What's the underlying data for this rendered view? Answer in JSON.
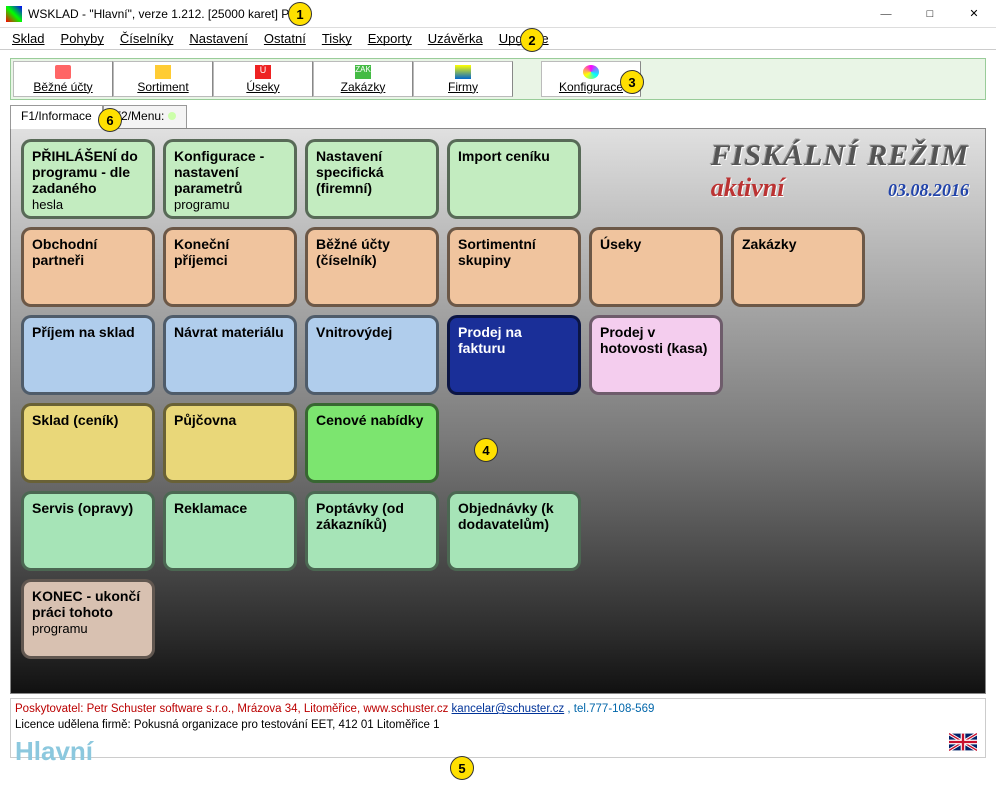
{
  "window": {
    "title": "WSKLAD - \"Hlavní\", verze 1.212. [25000 karet] PC2:"
  },
  "menu": {
    "items": [
      "Sklad",
      "Pohyby",
      "Číselníky",
      "Nastavení",
      "Ostatní",
      "Tisky",
      "Exporty",
      "Uzávěrka",
      "Upgrade"
    ]
  },
  "toolbar": {
    "items": [
      "Běžné účty",
      "Sortiment",
      "Úseky",
      "Zakázky",
      "Firmy",
      "Konfigurace"
    ]
  },
  "tabs": {
    "t0": "F1/Informace",
    "t1": "F2/Menu:"
  },
  "fiscal": {
    "title": "FISKÁLNÍ REŽIM",
    "state": "aktivní",
    "date": "03.08.2016"
  },
  "tiles": {
    "r0": [
      {
        "l": "PŘIHLÁŠENÍ do programu - dle zadaného",
        "s": "hesla"
      },
      {
        "l": "Konfigurace -nastavení parametrů",
        "s": "programu"
      },
      {
        "l": "Nastavení specifická (firemní)",
        "s": ""
      },
      {
        "l": "Import ceníku",
        "s": ""
      }
    ],
    "r1": [
      {
        "l": "Obchodní partneři"
      },
      {
        "l": "Koneční příjemci"
      },
      {
        "l": "Běžné účty (číselník)"
      },
      {
        "l": "Sortimentní skupiny"
      },
      {
        "l": "Úseky"
      },
      {
        "l": "Zakázky"
      }
    ],
    "r2": [
      {
        "l": "Příjem na sklad"
      },
      {
        "l": "Návrat materiálu"
      },
      {
        "l": "Vnitrovýdej"
      },
      {
        "l": "Prodej na fakturu"
      },
      {
        "l": "Prodej v hotovosti (kasa)"
      }
    ],
    "r3": [
      {
        "l": "Sklad (ceník)"
      },
      {
        "l": "Půjčovna"
      },
      {
        "l": "Cenové nabídky"
      }
    ],
    "r4": [
      {
        "l": "Servis (opravy)"
      },
      {
        "l": "Reklamace"
      },
      {
        "l": "Poptávky (od zákazníků)"
      },
      {
        "l": "Objednávky (k dodavatelům)"
      }
    ],
    "r5": [
      {
        "l": "KONEC - ukončí práci tohoto",
        "s": "programu"
      }
    ]
  },
  "footer": {
    "provider_label": "Poskytovatel: ",
    "provider_text": "Petr Schuster software s.r.o., Mrázova 34, Litoměřice, www.schuster.cz ",
    "email": "kancelar@schuster.cz",
    "tel": " , tel.777-108-569",
    "licence": "Licence udělena firmě: Pokusná organizace pro testování EET, 412 01 Litoměřice 1",
    "brand": "Hlavní"
  },
  "annotations": {
    "a1": "1",
    "a2": "2",
    "a3": "3",
    "a4": "4",
    "a5": "5",
    "a6": "6"
  }
}
